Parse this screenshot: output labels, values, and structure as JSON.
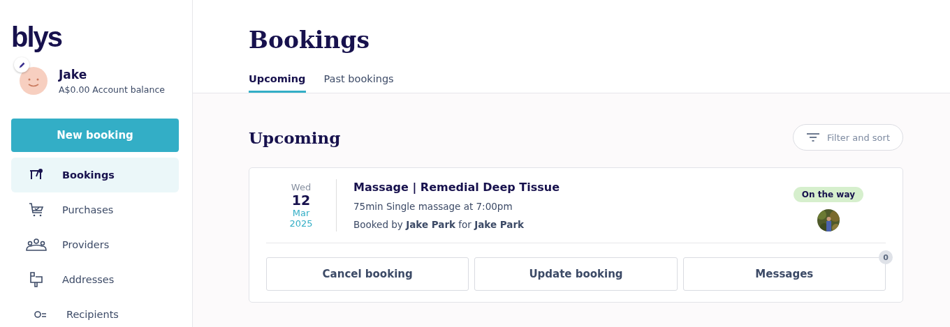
{
  "logo": "blys",
  "user": {
    "name": "Jake",
    "balance": "A$0.00 Account balance"
  },
  "new_booking": "New booking",
  "nav": [
    {
      "label": "Bookings",
      "selected": true
    },
    {
      "label": "Purchases",
      "selected": false
    },
    {
      "label": "Providers",
      "selected": false
    },
    {
      "label": "Addresses",
      "selected": false
    },
    {
      "label": "Recipients",
      "selected": false
    }
  ],
  "title": "Bookings",
  "tabs": [
    {
      "label": "Upcoming",
      "selected": true
    },
    {
      "label": "Past bookings",
      "selected": false
    }
  ],
  "section_title": "Upcoming",
  "filter": "Filter and sort",
  "bookings": [
    {
      "weekday": "Wed",
      "day": "12",
      "month": "Mar",
      "year": "2025",
      "service": "Massage | Remedial Deep Tissue",
      "detail": "75min Single massage at 7:00pm",
      "booked_by": "Booked by **Jake Park** for **Jake Park**",
      "status": "On the way",
      "actions": [
        "Cancel booking",
        "Update booking",
        "Messages"
      ],
      "message_count": "0"
    }
  ]
}
